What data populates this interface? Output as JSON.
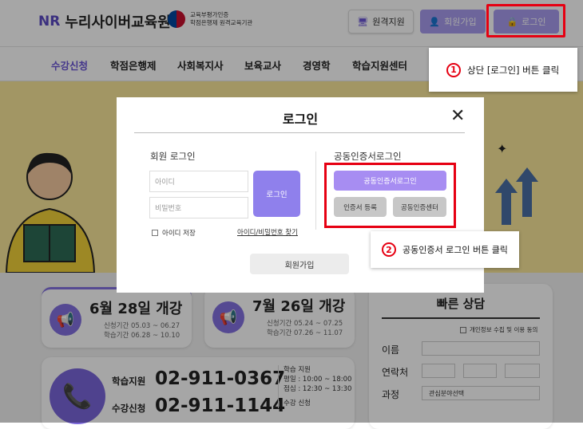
{
  "header": {
    "logo_mark": "NR",
    "logo_text": "누리사이버교육원",
    "cert_line1": "교육부평가인증",
    "cert_line2": "학점은행제 원격교육기관",
    "remote_label": "원격지원",
    "join_label": "회원가입",
    "login_label": "로그인"
  },
  "nav": {
    "items": [
      "수강신청",
      "학점은행제",
      "사회복지사",
      "보육교사",
      "경영학",
      "학습지원센터"
    ]
  },
  "callouts": {
    "one_num": "1",
    "one_text": "상단 [로그인] 버튼 클릭",
    "two_num": "2",
    "two_text": "공동인증서 로그인 버튼 클릭"
  },
  "lower": {
    "open1_title": "6월 28일 개강",
    "open1_line1": "신청기간 05.03 ~ 06.27",
    "open1_line2": "학습기간 06.28 ~ 10.10",
    "open2_title": "7월 26일 개강",
    "open2_line1": "신청기간 05.24 ~ 07.25",
    "open2_line2": "학습기간 07.26 ~ 11.07",
    "tel1_label": "학습지원",
    "tel1_num": "02-911-0367",
    "tel2_label": "수강신청",
    "tel2_num": "02-911-1144",
    "hours_title": "학습 지원",
    "hours_weekday": "평일 : 10:00 ~ 18:00",
    "hours_lunch": "점심 : 12:30 ~ 13:30",
    "hours_title2": "수강 신청",
    "qc_title": "빠른 상담",
    "qc_agree": "개인정보 수집 및 이용 동의",
    "qc_name": "이름",
    "qc_phone": "연락처",
    "qc_course": "과정",
    "qc_course_value": "관심분야선택"
  },
  "modal": {
    "title": "로그인",
    "close": "✕",
    "member_title": "회원 로그인",
    "id_placeholder": "아이디",
    "pw_placeholder": "비밀번호",
    "login_button": "로그인",
    "save_id": "아이디 저장",
    "find": "아이디/비밀번호 찾기",
    "cert_title": "공동인증서로그인",
    "cert_login": "공동인증서로그인",
    "cert_register": "인증서 등록",
    "cert_center": "공동인증센터",
    "join_button": "회원가입"
  },
  "icons": {
    "remote": "monitor-icon",
    "join": "user-icon",
    "login": "lock-icon",
    "close": "close-icon",
    "megaphone": "megaphone-icon",
    "phone": "phone-icon"
  },
  "colors": {
    "accent": "#8370e0",
    "button": "#a89bef",
    "highlight": "#e60012",
    "banner": "#f9e69a"
  }
}
